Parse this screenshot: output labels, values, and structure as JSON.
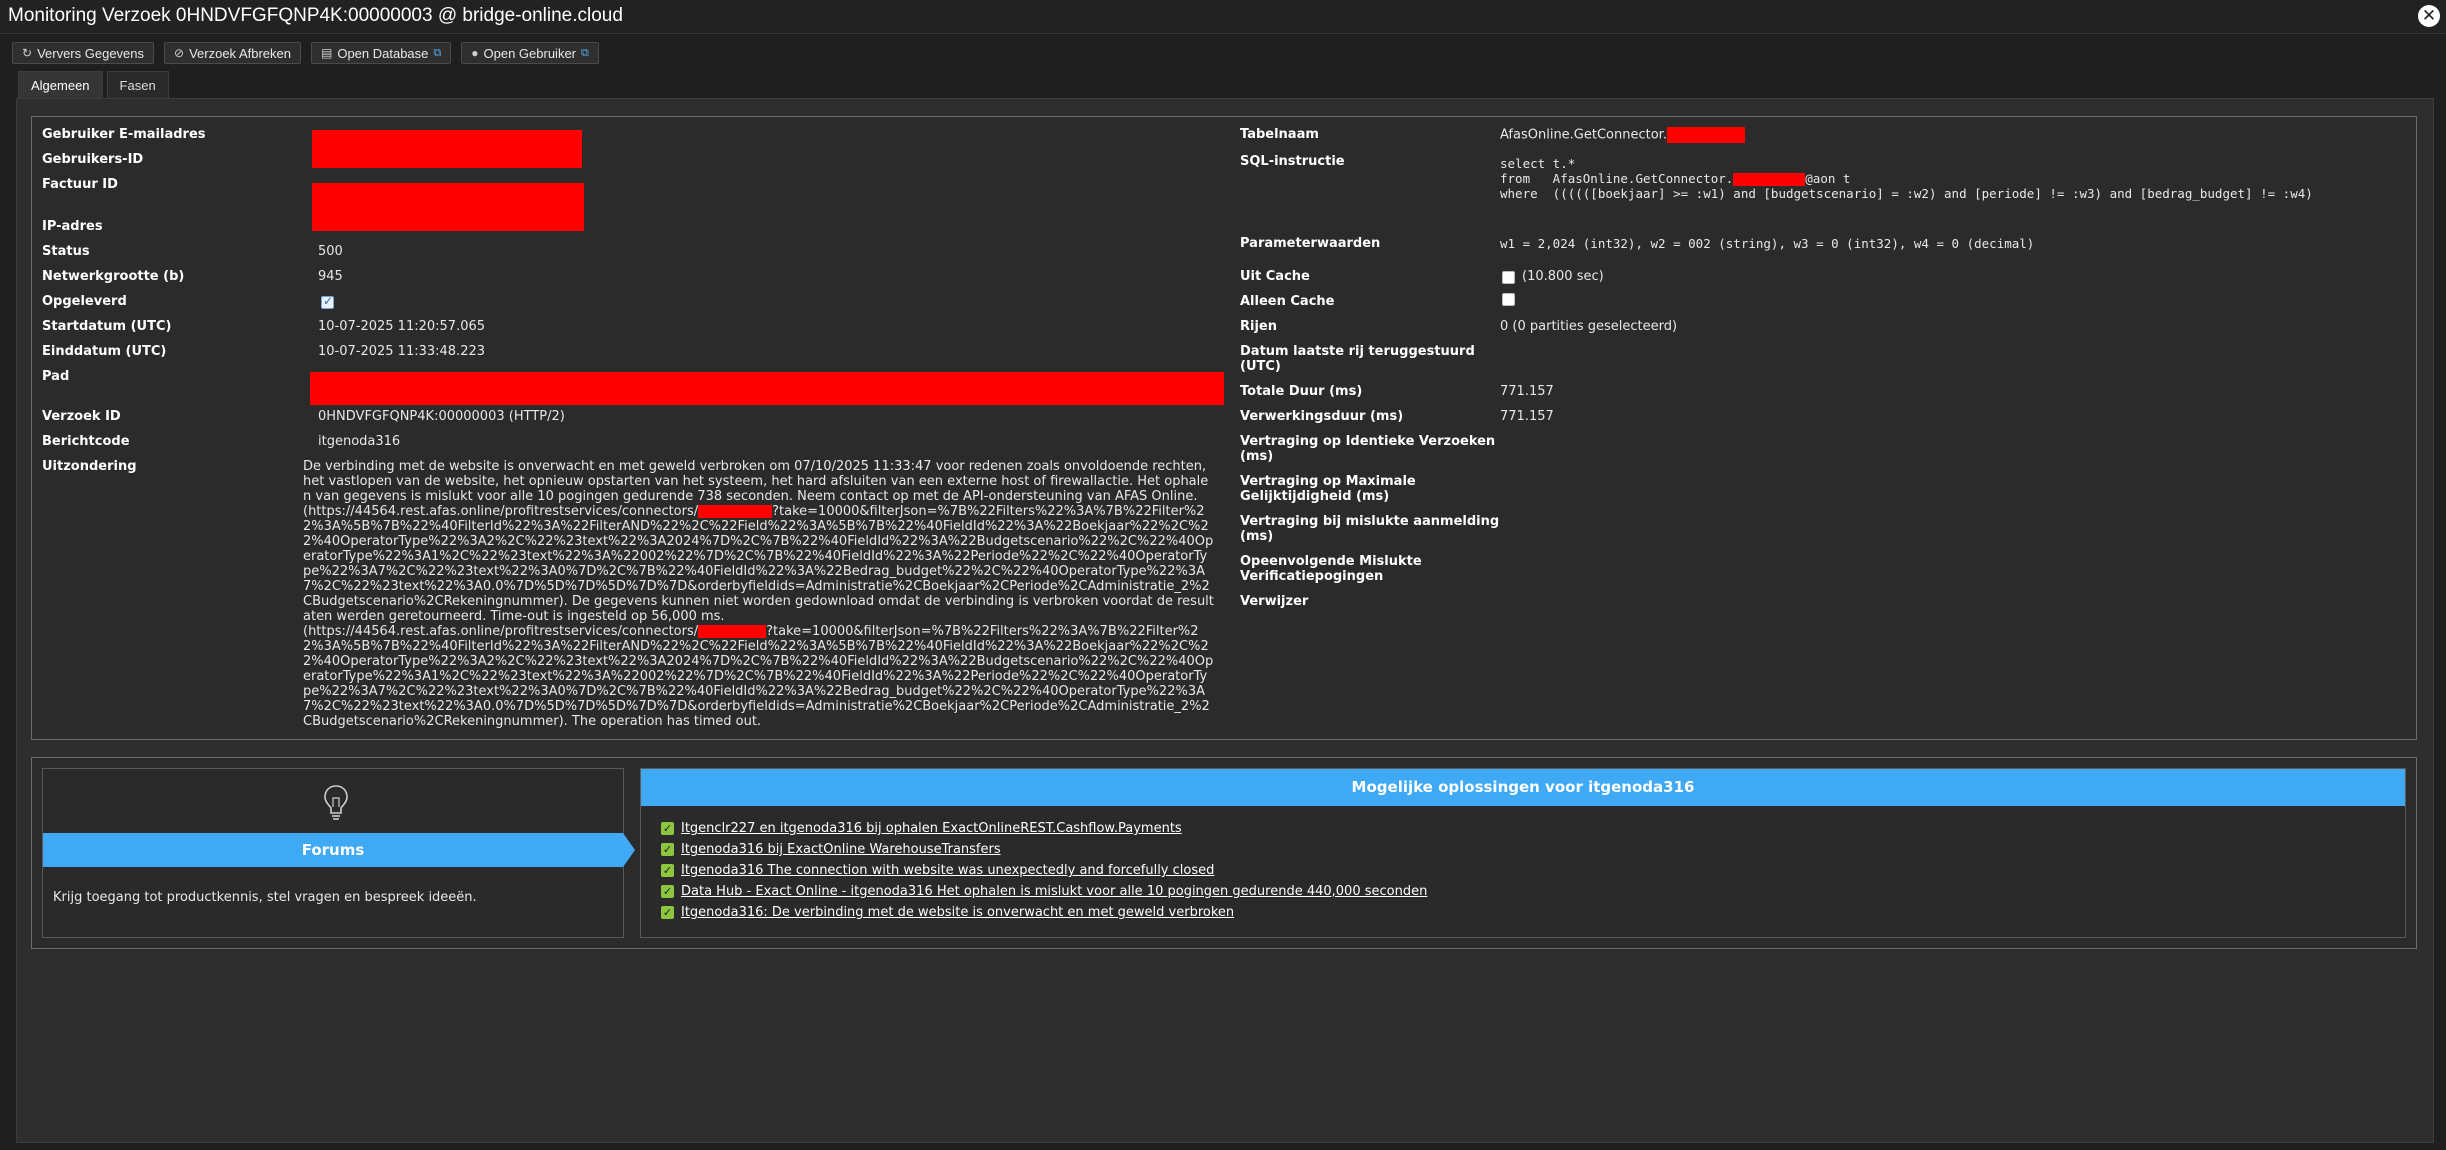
{
  "window": {
    "title": "Monitoring Verzoek 0HNDVFGFQNP4K:00000003 @ bridge-online.cloud"
  },
  "toolbar": {
    "refresh_label": "Ververs Gegevens",
    "abort_label": "Verzoek Afbreken",
    "open_db_label": "Open Database",
    "open_user_label": "Open Gebruiker"
  },
  "tabs": {
    "general": "Algemeen",
    "phases": "Fasen"
  },
  "left": {
    "email_label": "Gebruiker E-mailadres",
    "user_id_label": "Gebruikers-ID",
    "invoice_label": "Factuur ID",
    "ip_label": "IP-adres",
    "status_label": "Status",
    "status_value": "500",
    "netsize_label": "Netwerkgrootte (b)",
    "netsize_value": "945",
    "delivered_label": "Opgeleverd",
    "start_label": "Startdatum (UTC)",
    "start_value": "10-07-2025 11:20:57.065",
    "end_label": "Einddatum (UTC)",
    "end_value": "10-07-2025 11:33:48.223",
    "path_label": "Pad",
    "request_id_label": "Verzoek ID",
    "request_id_value": "0HNDVFGFQNP4K:00000003 (HTTP/2)",
    "msgcode_label": "Berichtcode",
    "msgcode_value": "itgenoda316",
    "exception_label": "Uitzondering",
    "exception_p1": "De verbinding met de website is onverwacht en met geweld verbroken om 07/10/2025 11:33:47 voor redenen zoals onvoldoende rechten, het vastlopen van de website, het opnieuw opstarten van het systeem, het hard afsluiten van een externe host of firewallactie. Het ophalen van gegevens is mislukt voor alle 10 pogingen gedurende 738 seconden. Neem contact op met de API-ondersteuning van AFAS Online.",
    "exception_url1_a": "(https://44564.rest.afas.online/profitrestservices/connectors/",
    "exception_url1_b": "?take=10000&filterJson=%7B%22Filters%22%3A%7B%22Filter%22%3A%5B%7B%22%40FilterId%22%3A%22FilterAND%22%2C%22Field%22%3A%5B%7B%22%40FieldId%22%3A%22Boekjaar%22%2C%22%40OperatorType%22%3A2%2C%22%23text%22%3A2024%7D%2C%7B%22%40FieldId%22%3A%22Budgetscenario%22%2C%22%40OperatorType%22%3A1%2C%22%23text%22%3A%22002%22%7D%2C%7B%22%40FieldId%22%3A%22Periode%22%2C%22%40OperatorType%22%3A7%2C%22%23text%22%3A0%7D%2C%7B%22%40FieldId%22%3A%22Bedrag_budget%22%2C%22%40OperatorType%22%3A7%2C%22%23text%22%3A0.0%7D%5D%7D%5D%7D%7D&orderbyfieldids=Administratie%2CBoekjaar%2CPeriode%2CAdministratie_2%2CBudgetscenario%2CRekeningnummer). De gegevens kunnen niet worden gedownload omdat de verbinding is verbroken voordat de resultaten werden geretourneerd. Time-out is ingesteld op 56,000 ms.",
    "exception_url2_a": "(https://44564.rest.afas.online/profitrestservices/connectors/",
    "exception_url2_b": "?take=10000&filterJson=%7B%22Filters%22%3A%7B%22Filter%22%3A%5B%7B%22%40FilterId%22%3A%22FilterAND%22%2C%22Field%22%3A%5B%7B%22%40FieldId%22%3A%22Boekjaar%22%2C%22%40OperatorType%22%3A2%2C%22%23text%22%3A2024%7D%2C%7B%22%40FieldId%22%3A%22Budgetscenario%22%2C%22%40OperatorType%22%3A1%2C%22%23text%22%3A%22002%22%7D%2C%7B%22%40FieldId%22%3A%22Periode%22%2C%22%40OperatorType%22%3A7%2C%22%23text%22%3A0%7D%2C%7B%22%40FieldId%22%3A%22Bedrag_budget%22%2C%22%40OperatorType%22%3A7%2C%22%23text%22%3A0.0%7D%5D%7D%5D%7D%7D&orderbyfieldids=Administratie%2CBoekjaar%2CPeriode%2CAdministratie_2%2CBudgetscenario%2CRekeningnummer). The operation has timed out."
  },
  "right": {
    "table_label": "Tabelnaam",
    "table_value": "AfasOnline.GetConnector.",
    "sql_label": "SQL-instructie",
    "sql_line1": "select t.*",
    "sql_line2a": "from   AfasOnline.GetConnector.",
    "sql_line2b": "@aon t",
    "sql_line3": "where  ((((([boekjaar] >= :w1) and [budgetscenario] = :w2) and [periode] != :w3) and [bedrag_budget] != :w4)",
    "params_label": "Parameterwaarden",
    "params_value": "w1 = 2,024 (int32), w2 = 002 (string), w3 = 0 (int32), w4 = 0 (decimal)",
    "from_cache_label": "Uit Cache",
    "from_cache_value": "(10.800 sec)",
    "cache_only_label": "Alleen Cache",
    "rows_label": "Rijen",
    "rows_value": "0 (0 partities geselecteerd)",
    "last_row_label_1": "Datum laatste rij teruggestuurd",
    "last_row_label_2": "(UTC)",
    "total_label": "Totale Duur (ms)",
    "total_value": "771.157",
    "processing_label": "Verwerkingsduur (ms)",
    "processing_value": "771.157",
    "delay_identical_1": "Vertraging op Identieke Verzoeken",
    "delay_identical_2": "(ms)",
    "delay_max_1": "Vertraging op Maximale",
    "delay_max_2": "Gelijktijdigheid (ms)",
    "delay_failed_1": "Vertraging bij mislukte aanmelding",
    "delay_failed_2": "(ms)",
    "consecutive_1": "Opeenvolgende Mislukte",
    "consecutive_2": "Verificatiepogingen",
    "referrer_label": "Verwijzer"
  },
  "forums": {
    "title": "Forums",
    "description": "Krijg toegang tot productkennis, stel vragen en bespreek ideeën."
  },
  "solutions": {
    "title": "Mogelijke oplossingen voor itgenoda316",
    "items": [
      "Itgenclr227 en itgenoda316 bij ophalen ExactOnlineREST.Cashflow.Payments",
      "Itgenoda316 bij ExactOnline WarehouseTransfers",
      "Itgenoda316 The connection with website was unexpectedly and forcefully closed",
      "Data Hub - Exact Online - itgenoda316 Het ophalen is mislukt voor alle 10 pogingen gedurende 440,000 seconden",
      "Itgenoda316: De verbinding met de website is onverwacht en met geweld verbroken"
    ]
  },
  "colors": {
    "accent": "#3fa9f5",
    "redaction": "#ff0000",
    "check": "#8cc63e"
  },
  "icons": [
    "refresh-icon",
    "ban-icon",
    "database-icon",
    "user-icon",
    "external-link-icon",
    "lightbulb-icon",
    "check-icon",
    "close-icon"
  ]
}
